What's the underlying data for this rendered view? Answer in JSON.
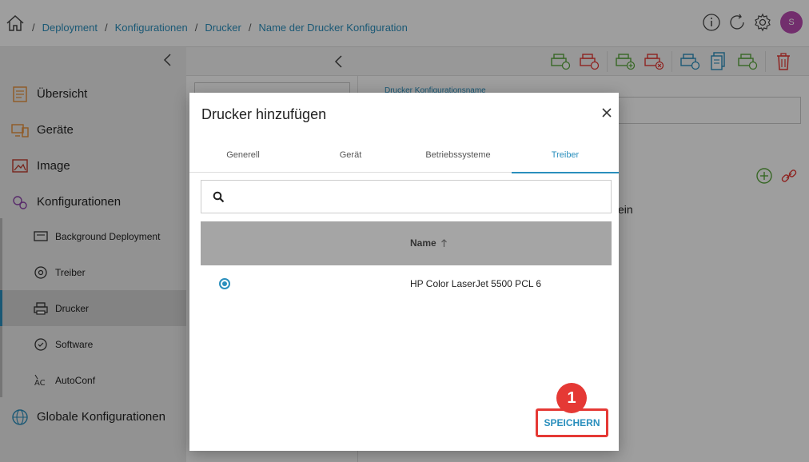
{
  "breadcrumb": {
    "items": [
      "Deployment",
      "Konfigurationen",
      "Drucker",
      "Name der Drucker Konfiguration"
    ],
    "separator": "/"
  },
  "header": {
    "icons": [
      "info-icon",
      "refresh-icon",
      "settings-icon"
    ],
    "avatar_initial": "S",
    "avatar_color": "#b84bb0"
  },
  "sidebar": {
    "items": [
      {
        "label": "Übersicht",
        "icon": "overview-icon"
      },
      {
        "label": "Geräte",
        "icon": "devices-icon"
      },
      {
        "label": "Image",
        "icon": "image-icon"
      },
      {
        "label": "Konfigurationen",
        "icon": "configurations-icon"
      }
    ],
    "sub_items": [
      {
        "label": "Background Deployment",
        "icon": "background-deployment-icon"
      },
      {
        "label": "Treiber",
        "icon": "driver-icon"
      },
      {
        "label": "Drucker",
        "icon": "printer-icon",
        "active": true
      },
      {
        "label": "Software",
        "icon": "software-icon"
      },
      {
        "label": "AutoConf",
        "icon": "autoconf-icon"
      }
    ],
    "global": {
      "label": "Globale Konfigurationen",
      "icon": "global-config-icon"
    }
  },
  "background": {
    "field_label": "Drucker Konfigurationsname",
    "partial_text": "ein"
  },
  "modal": {
    "title": "Drucker hinzufügen",
    "tabs": [
      {
        "label": "Generell",
        "active": false
      },
      {
        "label": "Gerät",
        "active": false
      },
      {
        "label": "Betriebssysteme",
        "active": false
      },
      {
        "label": "Treiber",
        "active": true
      }
    ],
    "search": {
      "value": "",
      "placeholder": ""
    },
    "table": {
      "columns": [
        {
          "label": "Name",
          "sort": "asc"
        }
      ],
      "rows": [
        {
          "selected": true,
          "name": "HP Color LaserJet 5500 PCL 6"
        }
      ]
    },
    "save_label": "SPEICHERN"
  },
  "annotation": {
    "step": "1"
  },
  "colors": {
    "accent": "#2a8fbd",
    "highlight": "#e53935",
    "table_header": "#a5a5a5",
    "sidebar": "#ececec"
  }
}
